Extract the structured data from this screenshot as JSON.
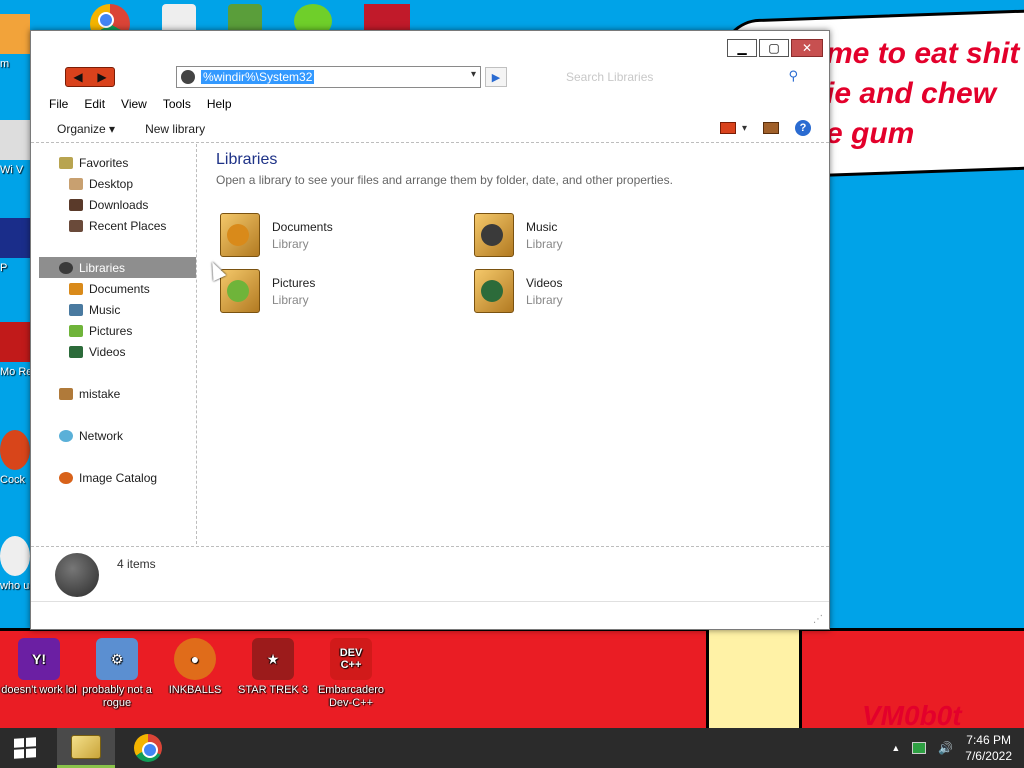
{
  "desktop": {
    "speech_text": "me to eat shit\nie and chew\ne gum",
    "watermark": "VM0b0t",
    "bottom_icons": [
      {
        "label": "doesn't work lol",
        "color": "#6b1fa3",
        "glyph": "Y!"
      },
      {
        "label": "probably not a rogue",
        "color": "#5b8fd1",
        "glyph": "⚙"
      },
      {
        "label": "INKBALLS",
        "color": "#e06c1a",
        "glyph": "●"
      },
      {
        "label": "STAR TREK 3",
        "color": "#9c1b1b",
        "glyph": "★"
      },
      {
        "label": "Embarcadero Dev-C++",
        "color": "#d11a1a",
        "glyph": "DEV C++"
      }
    ],
    "left_edge": [
      {
        "label": "m",
        "color": "#f2a33a"
      },
      {
        "label": "Wi V",
        "color": "#dddddd"
      },
      {
        "label": "P",
        "color": "#1a2d8a"
      },
      {
        "label": "Mo Re",
        "color": "#c11a1a"
      },
      {
        "label": "Cock",
        "color": "#d8451a"
      },
      {
        "label": "who us",
        "color": "#eeeeee"
      }
    ]
  },
  "window": {
    "controls": {
      "minimize": "▁",
      "maximize": "▢",
      "close": "✕"
    },
    "address": "%windir%\\System32",
    "search_placeholder": "Search Libraries",
    "menu": [
      "File",
      "Edit",
      "View",
      "Tools",
      "Help"
    ],
    "toolbar": {
      "organize": "Organize ▾",
      "new_library": "New library"
    },
    "nav": {
      "favorites": {
        "label": "Favorites",
        "items": [
          "Desktop",
          "Downloads",
          "Recent Places"
        ]
      },
      "libraries": {
        "label": "Libraries",
        "items": [
          "Documents",
          "Music",
          "Pictures",
          "Videos"
        ]
      },
      "others": [
        "mistake",
        "Network",
        "Image Catalog"
      ]
    },
    "content": {
      "title": "Libraries",
      "subtitle": "Open a library to see your files and arrange them by folder, date, and other properties.",
      "libraries": [
        {
          "name": "Documents",
          "type": "Library",
          "badge": "#d98a1a"
        },
        {
          "name": "Music",
          "type": "Library",
          "badge": "#3a3a3a"
        },
        {
          "name": "Pictures",
          "type": "Library",
          "badge": "#6fb43a"
        },
        {
          "name": "Videos",
          "type": "Library",
          "badge": "#2c6b3a"
        }
      ]
    },
    "details": {
      "count": "4 items"
    }
  },
  "taskbar": {
    "time": "7:46 PM",
    "date": "7/6/2022",
    "tray_up": "▲",
    "volume": "🔊"
  }
}
